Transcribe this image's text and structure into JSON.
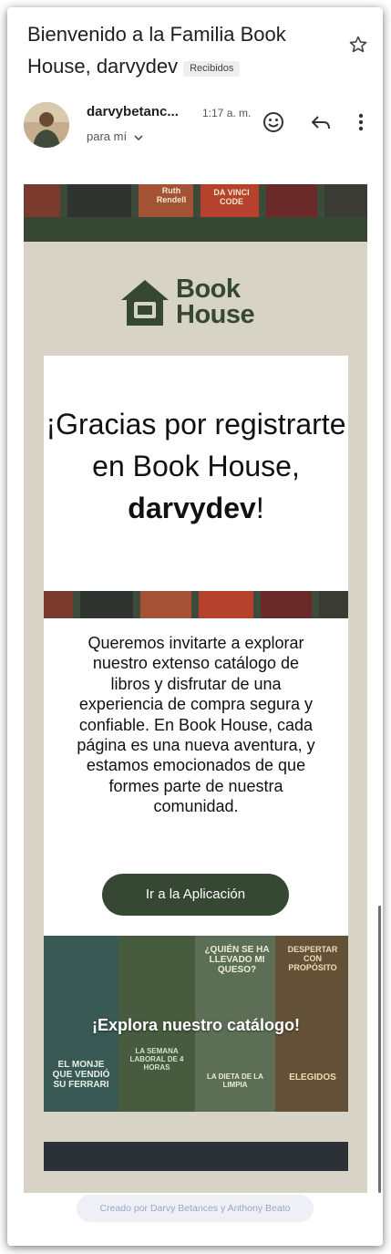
{
  "email": {
    "subject": "Bienvenido a la Familia Book House, darvydev",
    "label": "Recibidos",
    "sender": "darvybetanc...",
    "time": "1:17 a. m.",
    "recipient": "para mí"
  },
  "icons": {
    "star": "star-icon",
    "emoji": "emoji-icon",
    "reply": "reply-icon",
    "more": "more-vert-icon",
    "recipient_toggle": "chevron-down-icon",
    "logo": "house-icon"
  },
  "content": {
    "logo_line1": "Book",
    "logo_line2": "House",
    "headline_lead": "¡Gracias por registrarte en Book House,",
    "headline_name": "darvydev",
    "headline_end": "!",
    "body": "Queremos invitarte a explorar nuestro extenso catálogo de libros y disfrutar de una experiencia de compra segura y confiable. En Book House, cada página es una nueva aventura, y estamos emocionados de que formes parte de nuestra comunidad.",
    "cta_label": "Ir a la Aplicación",
    "catalog_banner": "¡Explora nuestro catálogo!",
    "book_titles": [
      "Ruth Rendell",
      "DA VINCI CODE",
      "¿QUIÉN SE HA LLEVADO MI QUESO?",
      "DESPERTAR CON PROPÓSITO",
      "EL MONJE QUE VENDIÓ SU FERRARI",
      "LA SEMANA LABORAL DE 4 HORAS",
      "LA DIETA DE LA LIMPIA",
      "ELEGIDOS"
    ]
  },
  "footer": "Creado por Darvy Betances y Anthony Beato",
  "colors": {
    "brand_green": "#364733",
    "email_bg": "#d7d3c6",
    "dark_bar": "#2c3138"
  }
}
